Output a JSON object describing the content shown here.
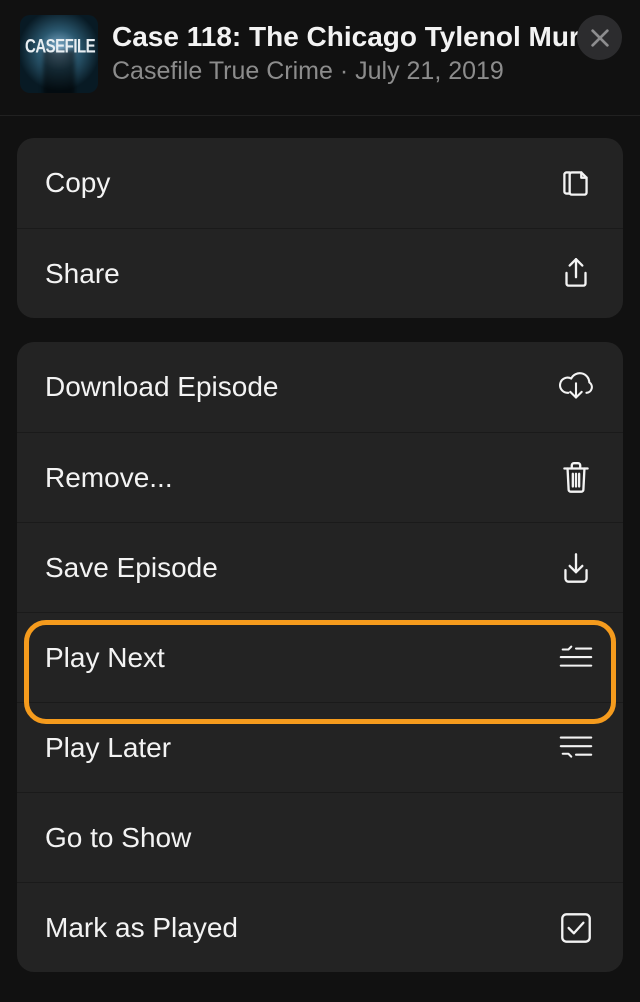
{
  "header": {
    "artwork_label": "CASEFILE",
    "title": "Case 118: The Chicago Tylenol Mur...",
    "subtitle": "Casefile True Crime · July 21, 2019"
  },
  "group1": {
    "copy": "Copy",
    "share": "Share"
  },
  "group2": {
    "download": "Download Episode",
    "remove": "Remove...",
    "save": "Save Episode",
    "play_next": "Play Next",
    "play_later": "Play Later",
    "go_to_show": "Go to Show",
    "mark_played": "Mark as Played"
  }
}
